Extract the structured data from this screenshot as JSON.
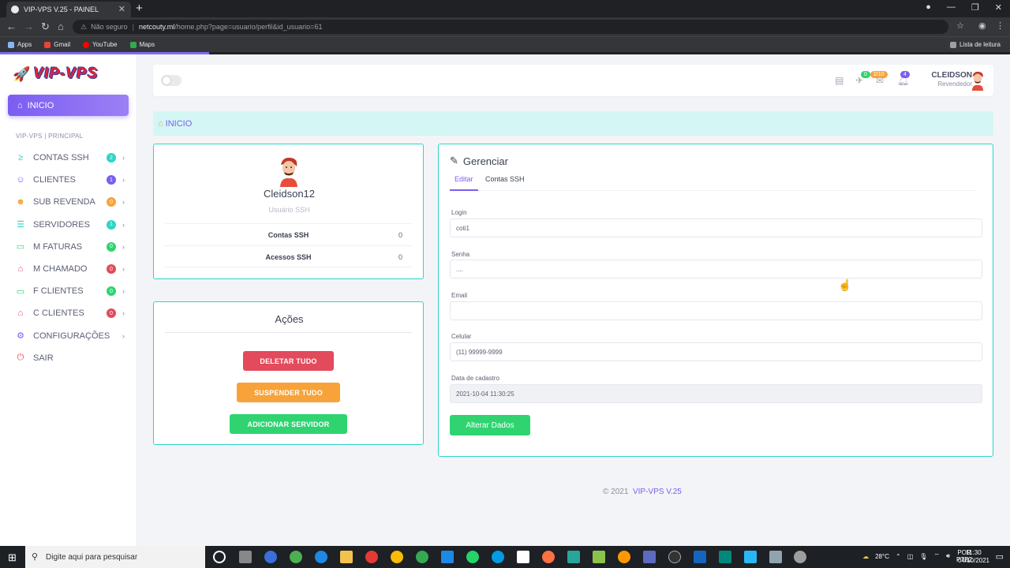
{
  "browser": {
    "tab_title": "VIP-VPS V.25 - PAINEL",
    "insecure_label": "Não seguro",
    "url_host": "netcouty.ml",
    "url_path": "/home.php?page=usuario/perfil&id_usuario=61",
    "bookmarks": [
      "Apps",
      "Gmail",
      "YouTube",
      "Maps"
    ],
    "reading_list": "Lista de leitura"
  },
  "sidebar": {
    "logo_text": "VIP-VPS",
    "active_item": "INICIO",
    "section_title": "VIP-VPS | PRINCIPAL",
    "items": [
      {
        "label": "CONTAS SSH",
        "icon": "terminal-icon",
        "badge": "2",
        "badge_color": "#2dd5c9",
        "color": "#2dd5c9"
      },
      {
        "label": "CLIENTES",
        "icon": "user-icon",
        "badge": "1",
        "badge_color": "#7c5df2",
        "color": "#7c5df2"
      },
      {
        "label": "SUB REVENDA",
        "icon": "users-icon",
        "badge": "0",
        "badge_color": "#f7a33a",
        "color": "#f7a33a"
      },
      {
        "label": "SERVIDORES",
        "icon": "server-icon",
        "badge": "1",
        "badge_color": "#2dd5c9",
        "color": "#2dd5c9"
      },
      {
        "label": "M FATURAS",
        "icon": "invoice-icon",
        "badge": "0",
        "badge_color": "#2fd471",
        "color": "#2fd471"
      },
      {
        "label": "M CHAMADO",
        "icon": "ticket-icon",
        "badge": "0",
        "badge_color": "#e34a5b",
        "color": "#e34a5b"
      },
      {
        "label": "F CLIENTES",
        "icon": "invoice-icon",
        "badge": "0",
        "badge_color": "#2fd471",
        "color": "#2fd471"
      },
      {
        "label": "C CLIENTES",
        "icon": "ticket-icon",
        "badge": "0",
        "badge_color": "#e34a5b",
        "color": "#e34a5b"
      },
      {
        "label": "CONFIGURAÇÕES",
        "icon": "gear-icon",
        "badge": "",
        "badge_color": "",
        "color": "#7c5df2"
      },
      {
        "label": "SAIR",
        "icon": "power-icon",
        "badge": "",
        "badge_color": "",
        "color": "#e34a5b"
      }
    ]
  },
  "topbar": {
    "notif_badge_1": "0",
    "notif_badge_2": "2/10",
    "notif_badge_3": "4",
    "user_name": "CLEIDSON",
    "user_role": "Revendedor"
  },
  "breadcrumb": "INICIO",
  "profile": {
    "name": "Cleidson12",
    "subtitle": "Usuário SSH",
    "rows": [
      {
        "label": "Contas SSH",
        "value": "0"
      },
      {
        "label": "Acessos SSH",
        "value": "0"
      }
    ]
  },
  "actions": {
    "title": "Ações",
    "delete_all": "DELETAR TUDO",
    "suspend_all": "SUSPENDER TUDO",
    "add_server": "ADICIONAR SERVIDOR"
  },
  "manage": {
    "title": "Gerenciar",
    "tab_edit": "Editar",
    "tab_ssh": "Contas SSH",
    "login_label": "Login",
    "login_value": "coti1",
    "password_label": "Senha",
    "password_value": "....",
    "email_label": "Email",
    "email_value": "",
    "phone_label": "Celular",
    "phone_value": "(11) 99999-9999",
    "created_label": "Data de cadastro",
    "created_value": "2021-10-04 11:30:25",
    "submit": "Alterar Dados"
  },
  "footer": {
    "copyright": "© 2021",
    "brand": "VIP-VPS V.25"
  },
  "taskbar": {
    "search_placeholder": "Digite aqui para pesquisar",
    "temperature": "28°C",
    "lang_1": "POR",
    "lang_2": "PTB2",
    "time": "11:30",
    "date": "04/10/2021"
  }
}
